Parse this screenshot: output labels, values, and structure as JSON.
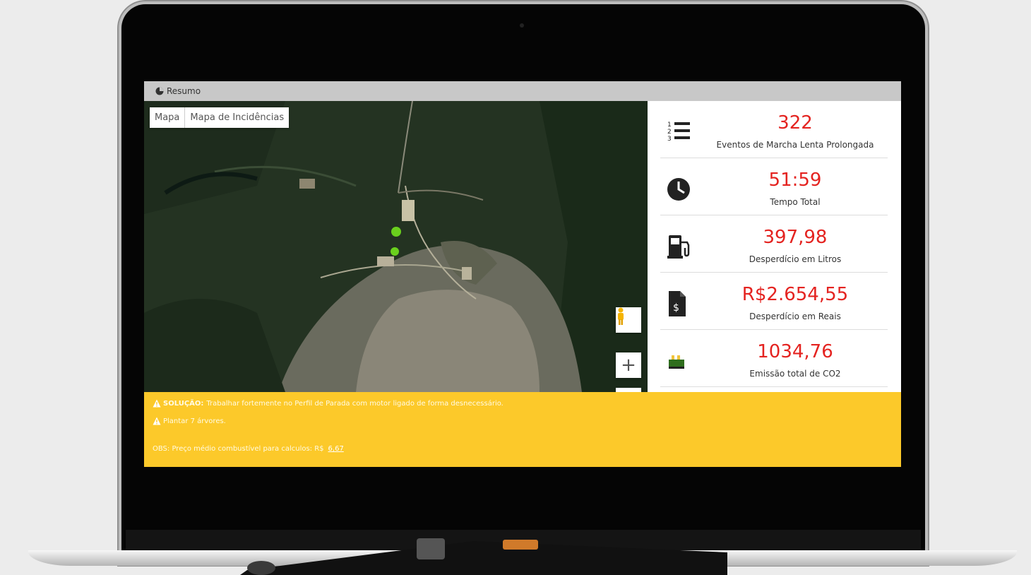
{
  "header": {
    "title": "Resumo",
    "icon": "pie-chart-icon"
  },
  "map": {
    "tabs": [
      {
        "label": "Mapa"
      },
      {
        "label": "Mapa de Incidências"
      }
    ],
    "controls": {
      "zoom_in_label": "+",
      "pegman_icon": "pegman-icon"
    }
  },
  "stats": [
    {
      "value": "322",
      "label": "Eventos de Marcha Lenta Prolongada",
      "icon": "numbered-list-icon"
    },
    {
      "value": "51:59",
      "label": "Tempo Total",
      "icon": "clock-icon"
    },
    {
      "value": "397,98",
      "label": "Desperdício em Litros",
      "icon": "fuel-pump-icon"
    },
    {
      "value": "R$2.654,55",
      "label": "Desperdício em Reais",
      "icon": "money-document-icon"
    },
    {
      "value": "1034,76",
      "label": "Emissão total de CO2",
      "icon": "co2-emission-icon"
    }
  ],
  "solution": {
    "line1_prefix": "SOLUÇÃO:",
    "line1_text": "Trabalhar fortemente no Perfil de Parada com motor ligado de forma desnecessário.",
    "line2_text": "Plantar 7 árvores.",
    "obs_text": "OBS: Preço médio combustível para calculos: R$",
    "obs_value": "6,67"
  },
  "colors": {
    "accent_red": "#e42320",
    "banner_yellow": "#fcc92a",
    "header_gray": "#c8c8c8"
  }
}
